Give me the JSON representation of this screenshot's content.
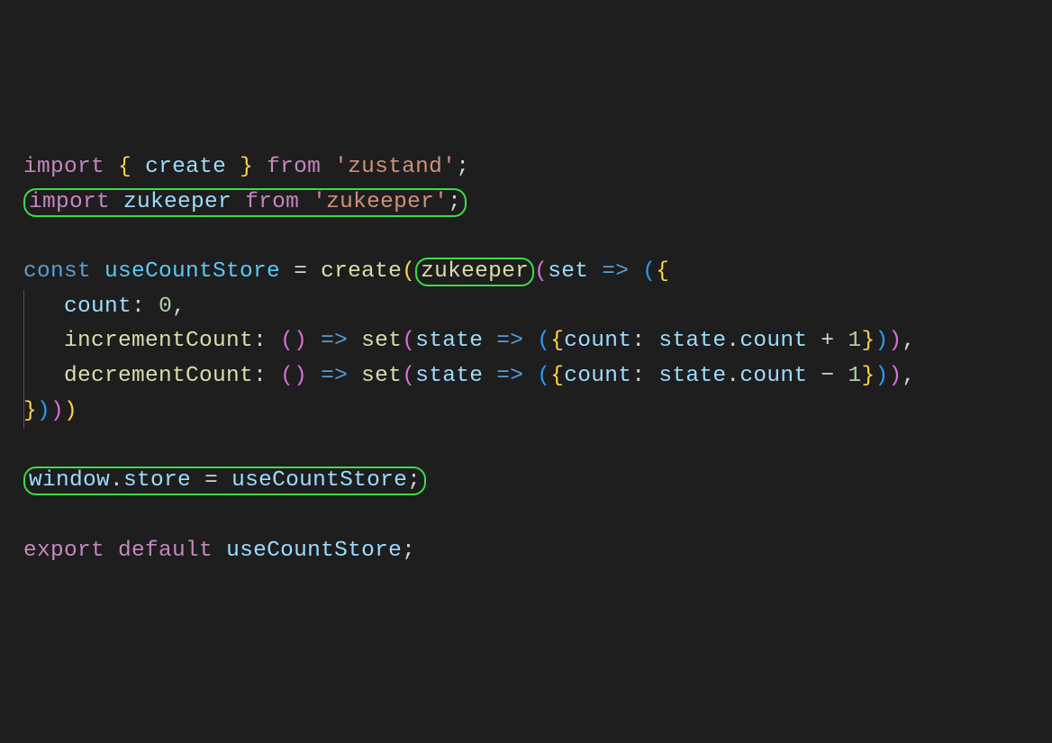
{
  "lines": {
    "l1": {
      "import": "import",
      "brace_l": "{",
      "create": "create",
      "brace_r": "}",
      "from": "from",
      "zustand": "'zustand'",
      "semi": ";"
    },
    "l2": {
      "import": "import",
      "zukeeper": "zukeeper",
      "from": "from",
      "zukeeper_str": "'zukeeper'",
      "semi": ";"
    },
    "l4": {
      "const": "const",
      "useCountStore": "useCountStore",
      "eq": "=",
      "create": "create",
      "lp1": "(",
      "zukeeper": "zukeeper",
      "lp2": "(",
      "set": "set",
      "arrow": "=>",
      "lp3": "(",
      "lb": "{"
    },
    "l5": {
      "count": "count",
      "colon": ":",
      "zero": "0",
      "comma": ","
    },
    "l6": {
      "incrementCount": "incrementCount",
      "colon1": ":",
      "lp1": "(",
      "rp1": ")",
      "arrow1": "=>",
      "set": "set",
      "lp2": "(",
      "state": "state",
      "arrow2": "=>",
      "lp3": "(",
      "lb": "{",
      "count": "count",
      "colon2": ":",
      "state2": "state",
      "dot": ".",
      "count2": "count",
      "plus": "+",
      "one": "1",
      "rb": "}",
      "rp3": ")",
      "rp2": ")",
      "comma": ","
    },
    "l7": {
      "decrementCount": "decrementCount",
      "colon1": ":",
      "lp1": "(",
      "rp1": ")",
      "arrow1": "=>",
      "set": "set",
      "lp2": "(",
      "state": "state",
      "arrow2": "=>",
      "lp3": "(",
      "lb": "{",
      "count": "count",
      "colon2": ":",
      "state2": "state",
      "dot": ".",
      "count2": "count",
      "minus": "−",
      "one": "1",
      "rb": "}",
      "rp3": ")",
      "rp2": ")",
      "comma": ","
    },
    "l8": {
      "rb": "}",
      "rp1": ")",
      "rp2": ")",
      "rp3": ")"
    },
    "l10": {
      "window": "window",
      "dot": ".",
      "store": "store",
      "eq": "=",
      "useCountStore": "useCountStore",
      "semi": ";"
    },
    "l12": {
      "export": "export",
      "default": "default",
      "useCountStore": "useCountStore",
      "semi": ";"
    }
  }
}
